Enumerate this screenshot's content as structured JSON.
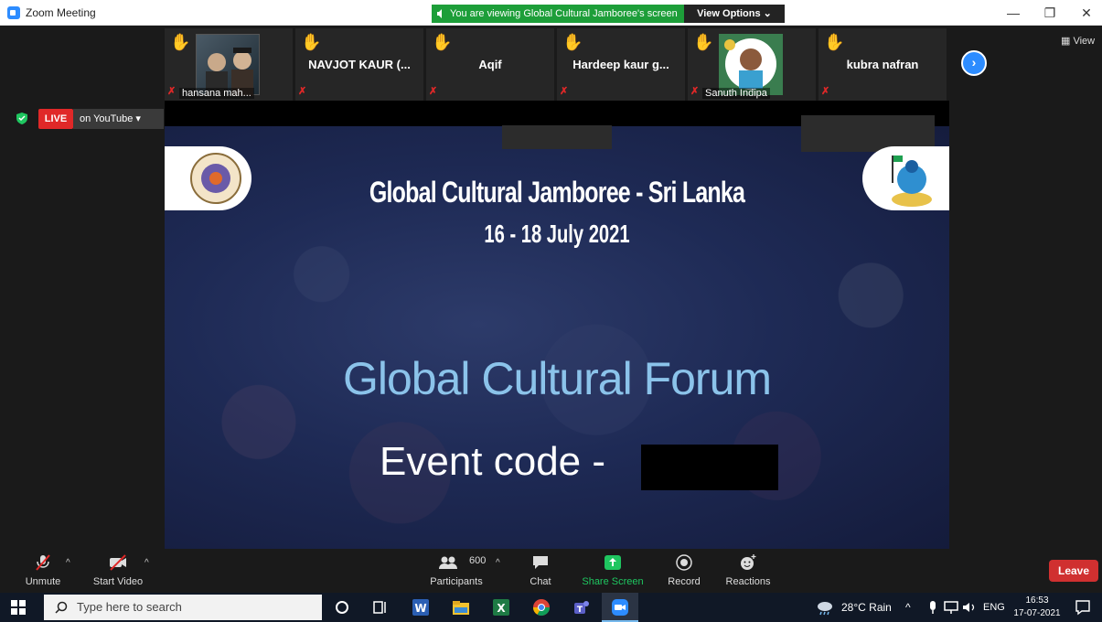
{
  "window": {
    "title": "Zoom Meeting",
    "banner": "You are viewing Global Cultural Jamboree's screen",
    "view_options": "View Options",
    "controls": [
      "minimize-icon",
      "restore-icon",
      "close-icon"
    ]
  },
  "participants": [
    {
      "name": "",
      "caption": "hansana mah...",
      "has_photo": true,
      "raised_hand": true,
      "muted": true
    },
    {
      "name": "NAVJOT KAUR (...",
      "caption": "",
      "has_photo": false,
      "raised_hand": true,
      "muted": true
    },
    {
      "name": "Aqif",
      "caption": "",
      "has_photo": false,
      "raised_hand": true,
      "muted": true
    },
    {
      "name": "Hardeep kaur g...",
      "caption": "",
      "has_photo": false,
      "raised_hand": true,
      "muted": true
    },
    {
      "name": "",
      "caption": "Sanuth Indipa",
      "has_photo": true,
      "raised_hand": true,
      "muted": true
    },
    {
      "name": "kubra nafran",
      "caption": "",
      "has_photo": false,
      "raised_hand": true,
      "muted": true
    }
  ],
  "view_button": "View",
  "live": {
    "badge": "LIVE",
    "platform": "on YouTube"
  },
  "shared_screen": {
    "title": "Global Cultural Jamboree - Sri Lanka",
    "dates": "16 - 18 July 2021",
    "forum": "Global Cultural Forum",
    "event_code_label": "Event code -"
  },
  "toolbar": {
    "unmute": "Unmute",
    "start_video": "Start Video",
    "participants_count": "600",
    "participants": "Participants",
    "chat": "Chat",
    "share_screen": "Share Screen",
    "record": "Record",
    "reactions": "Reactions",
    "leave": "Leave"
  },
  "taskbar": {
    "search_placeholder": "Type here to search",
    "weather": "28°C  Rain",
    "language": "ENG",
    "time": "16:53",
    "date": "17-07-2021"
  },
  "colors": {
    "zoom_blue": "#2D8CFF",
    "banner_green": "#1d9e39",
    "live_red": "#e02828",
    "share_green": "#1fc660",
    "forum_text": "#8bc3ea"
  }
}
